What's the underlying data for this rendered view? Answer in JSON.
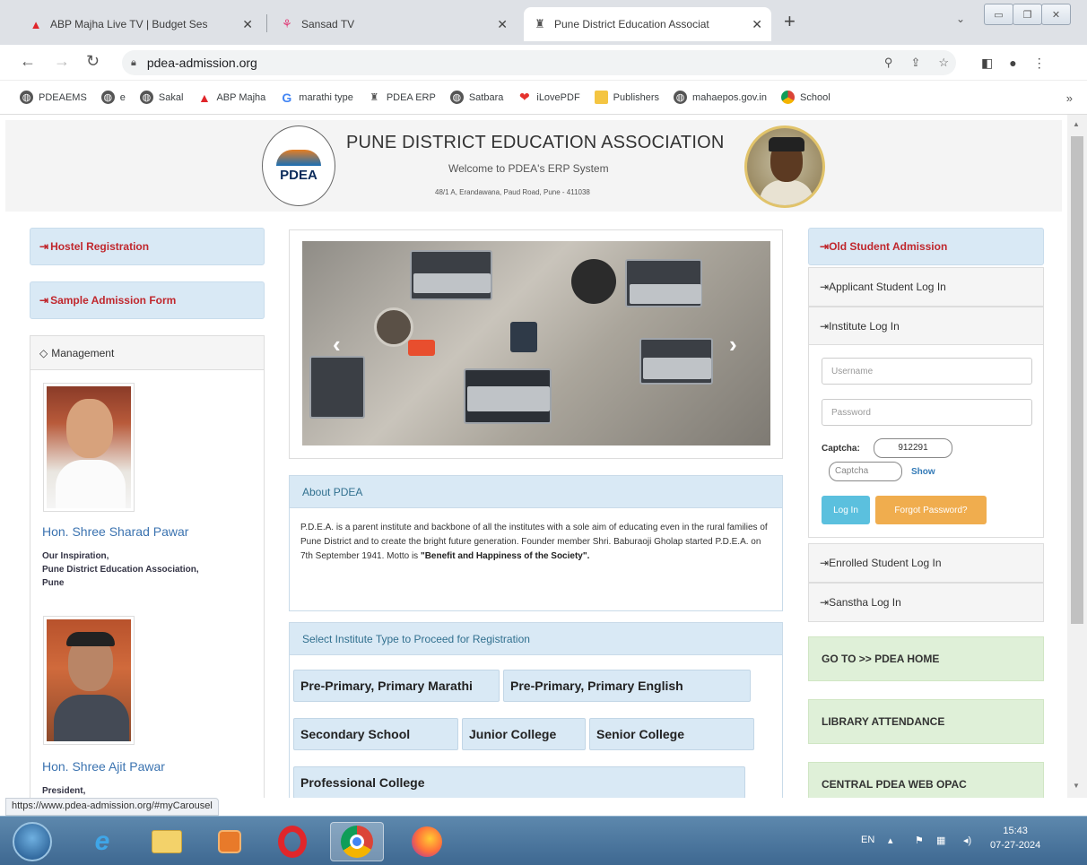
{
  "browser": {
    "tabs": [
      {
        "title": "ABP Majha Live TV | Budget Ses",
        "icon": "abp-majha-icon",
        "close": "✕"
      },
      {
        "title": "Sansad TV",
        "icon": "sansad-tv-icon",
        "close": "✕"
      },
      {
        "title": "Pune District Education Associat",
        "icon": "pdea-icon",
        "close": "✕"
      }
    ],
    "new_tab": "+",
    "url": "pdea-admission.org",
    "bookmarks": [
      {
        "label": "PDEAEMS",
        "icon": "globe-icon"
      },
      {
        "label": "e",
        "icon": "globe-icon"
      },
      {
        "label": "Sakal",
        "icon": "globe-icon"
      },
      {
        "label": "ABP Majha",
        "icon": "abp-majha-icon"
      },
      {
        "label": "marathi type",
        "icon": "google-icon"
      },
      {
        "label": "PDEA ERP",
        "icon": "pdea-icon"
      },
      {
        "label": "Satbara",
        "icon": "globe-icon"
      },
      {
        "label": "iLovePDF",
        "icon": "ilovepdf-icon"
      },
      {
        "label": "Publishers",
        "icon": "folder-icon"
      },
      {
        "label": "mahaepos.gov.in",
        "icon": "globe-icon"
      },
      {
        "label": "School",
        "icon": "chrome-icon"
      }
    ],
    "status_url": "https://www.pdea-admission.org/#myCarousel"
  },
  "header": {
    "logo_text": "PDEA",
    "title": "PUNE DISTRICT EDUCATION ASSOCIATION",
    "welcome": "Welcome to PDEA's ERP System",
    "address": "48/1 A, Erandawana, Paud Road, Pune - 411038"
  },
  "left": {
    "hostel": "Hostel Registration",
    "sample": "Sample Admission Form",
    "management_title": "Management",
    "people": [
      {
        "name": "Hon. Shree Sharad Pawar",
        "desc": [
          "Our Inspiration,",
          "Pune District Education Association,",
          "Pune"
        ]
      },
      {
        "name": "Hon. Shree Ajit Pawar",
        "desc": [
          "President,"
        ]
      }
    ]
  },
  "center": {
    "about_title": "About PDEA",
    "about_text": "P.D.E.A. is a parent institute and backbone of all the institutes with a sole aim of educating even in the rural families of Pune District and to create the bright future generation. Founder member Shri. Baburaoji Gholap started P.D.E.A. on 7th September 1941. Motto is ",
    "about_motto": "\"Benefit and Happiness of the Society\".",
    "select_title": "Select Institute Type to Proceed for Registration",
    "institute_types": [
      "Pre-Primary, Primary Marathi",
      "Pre-Primary, Primary English",
      "Secondary School",
      "Junior College",
      "Senior College",
      "Professional College"
    ]
  },
  "right": {
    "old_admission": "Old Student Admission",
    "applicant_login": "Applicant Student Log In",
    "institute_login": "Institute Log In",
    "username_placeholder": "Username",
    "password_placeholder": "Password",
    "captcha_label": "Captcha:",
    "captcha_code": "912291",
    "captcha_placeholder": "Captcha",
    "show": "Show",
    "login_btn": "Log In",
    "forgot_btn": "Forgot Password?",
    "enrolled_login": "Enrolled Student Log In",
    "sanstha_login": "Sanstha Log In",
    "go_home": "GO TO >> PDEA HOME",
    "library": "LIBRARY ATTENDANCE",
    "opac": "CENTRAL PDEA WEB OPAC"
  },
  "taskbar": {
    "lang": "EN",
    "time": "15:43",
    "date": "07-27-2024"
  },
  "colors": {
    "accent_red": "#c0272d",
    "panel_blue": "#d9e9f5",
    "green": "#dff0d8"
  }
}
